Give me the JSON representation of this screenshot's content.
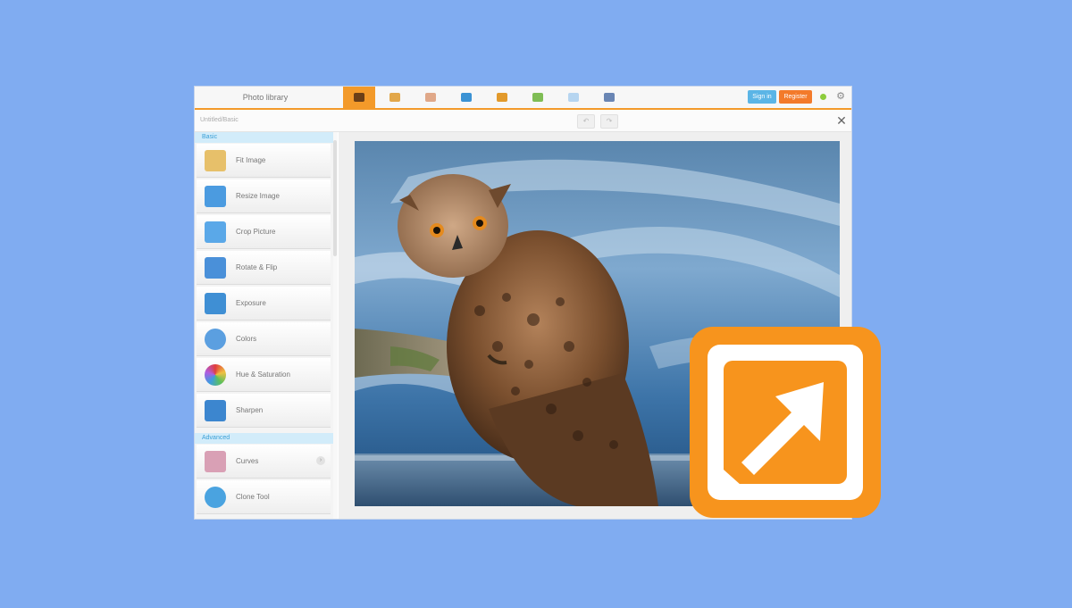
{
  "app": {
    "title": "Photo library",
    "toolbar_tools": [
      {
        "icon": "photo-icon",
        "color": "#6b3f17",
        "active": true
      },
      {
        "icon": "magic-wand-icon",
        "color": "#e2a74a",
        "active": false
      },
      {
        "icon": "portrait-icon",
        "color": "#e0a889",
        "active": false
      },
      {
        "icon": "layers-icon",
        "color": "#3b92d4",
        "active": false
      },
      {
        "icon": "frame-icon",
        "color": "#e29a2c",
        "active": false
      },
      {
        "icon": "picture-icon",
        "color": "#7fbd55",
        "active": false
      },
      {
        "icon": "collage-icon",
        "color": "#b6d5f0",
        "active": false
      },
      {
        "icon": "save-icon",
        "color": "#6a86b4",
        "active": false
      }
    ],
    "sign_in_label": "Sign in",
    "register_label": "Register"
  },
  "subbar": {
    "crumb": "Untitled/Basic",
    "undo_glyph": "↶",
    "redo_glyph": "↷"
  },
  "sidebar": {
    "sections": [
      {
        "label": "Basic"
      },
      {
        "label": "Advanced"
      }
    ],
    "items": [
      {
        "label": "Fit Image",
        "icon": "fit-image-icon",
        "color": "#e7c06a"
      },
      {
        "label": "Resize Image",
        "icon": "resize-image-icon",
        "color": "#4b9be0"
      },
      {
        "label": "Crop Picture",
        "icon": "crop-icon",
        "color": "#5aa8e8"
      },
      {
        "label": "Rotate & Flip",
        "icon": "rotate-icon",
        "color": "#4a90d9"
      },
      {
        "label": "Exposure",
        "icon": "exposure-icon",
        "color": "#3f8fd4"
      },
      {
        "label": "Colors",
        "icon": "colors-icon",
        "color": "#5b9fe0"
      },
      {
        "label": "Hue & Saturation",
        "icon": "hue-saturation-icon",
        "color": "#e08a3c"
      },
      {
        "label": "Sharpen",
        "icon": "sharpen-icon",
        "color": "#3c86cf"
      },
      {
        "label": "Curves",
        "icon": "curves-icon",
        "color": "#d9a0b5"
      },
      {
        "label": "Clone Tool",
        "icon": "clone-tool-icon",
        "color": "#4aa3e0"
      }
    ]
  },
  "canvas": {
    "image_subject": "owl-photo"
  },
  "overlay": {
    "logo_color": "#f7941d"
  }
}
